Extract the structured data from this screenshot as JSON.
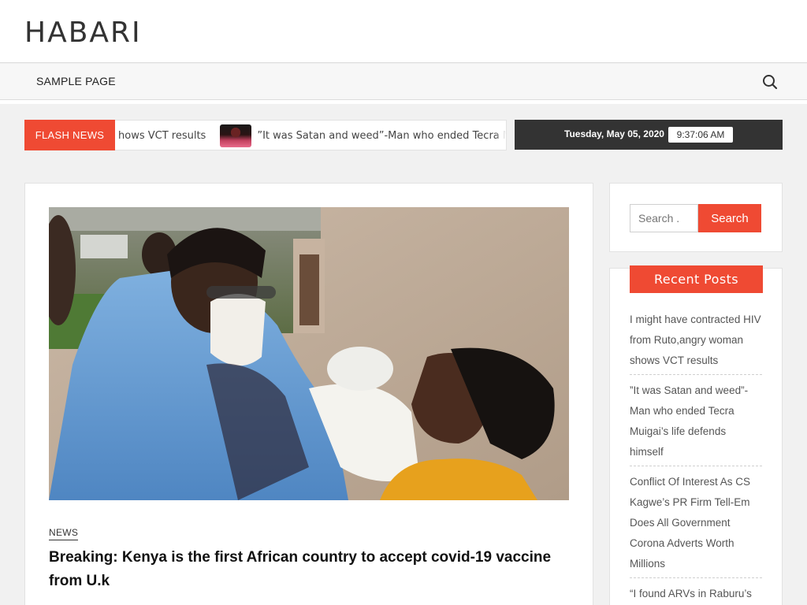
{
  "header": {
    "site_title": "HABARI"
  },
  "nav": {
    "items": [
      {
        "label": "SAMPLE PAGE"
      }
    ],
    "search_icon": "search-icon"
  },
  "ticker": {
    "label": "FLASH NEWS",
    "items": [
      {
        "text": "hows VCT results"
      },
      {
        "text": "”It was Satan and weed”-Man who ended Tecra M"
      }
    ]
  },
  "datebar": {
    "date": "Tuesday, May 05, 2020",
    "time": "9:37:06 AM"
  },
  "post": {
    "category": "NEWS",
    "title": "Breaking: Kenya is the first African country to accept covid-19 vaccine from U.k"
  },
  "sidebar": {
    "search": {
      "placeholder": "Search .",
      "button_label": "Search"
    },
    "recent": {
      "title": "Recent Posts",
      "items": [
        "I might have contracted HIV from Ruto,angry woman shows VCT results",
        "”It was Satan and weed”-Man who ended Tecra Muigai’s life defends himself",
        "Conflict Of Interest As CS Kagwe’s PR Firm Tell-Em Does All Government Corona Adverts Worth Millions",
        "“I found ARVs in Raburu’s"
      ]
    }
  },
  "colors": {
    "accent": "#ef4a33",
    "datebar_bg": "#333333",
    "page_bg": "#f1f1f1"
  }
}
